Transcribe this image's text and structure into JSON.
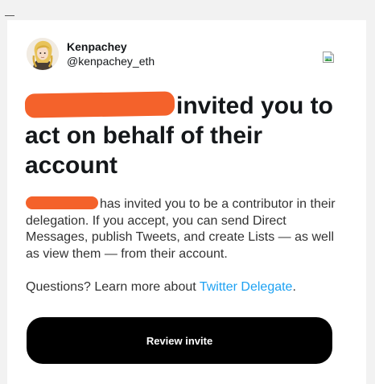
{
  "sender": {
    "display_name": "Kenpachey",
    "handle": "@kenpachey_eth"
  },
  "email": {
    "headline_rest": "invited you to act on behalf of their account",
    "body_rest": "has invited you to be a contributor in their delegation. If you accept, you can send Direct Messages, publish Tweets, and create Lists — as well as view them — from their account.",
    "questions_prefix": "Questions? Learn more about",
    "link_text": "Twitter Delegate",
    "questions_suffix": ".",
    "button_label": "Review invite"
  },
  "icons": {
    "header_image": "broken-image-icon"
  },
  "colors": {
    "redaction": "#f4622b",
    "link": "#1da1f2",
    "button_bg": "#000000",
    "button_text": "#ffffff"
  }
}
